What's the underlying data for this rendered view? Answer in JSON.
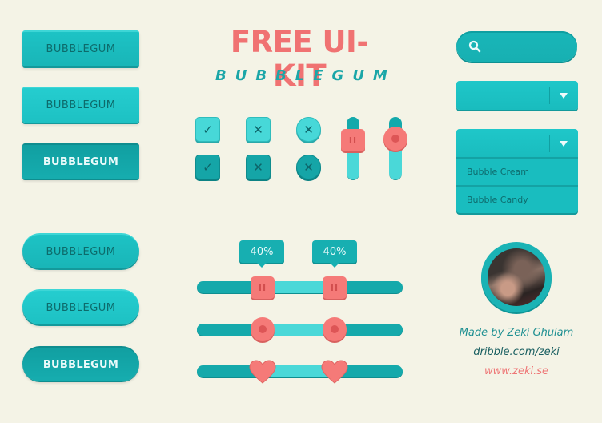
{
  "header": {
    "title": "FREE UI-KIT",
    "subtitle": "BUBBLEGUM"
  },
  "buttons": {
    "square": [
      {
        "label": "BUBBLEGUM",
        "state": "normal"
      },
      {
        "label": "BUBBLEGUM",
        "state": "hover"
      },
      {
        "label": "BUBBLEGUM",
        "state": "active"
      }
    ],
    "pill": [
      {
        "label": "BUBBLEGUM",
        "state": "normal"
      },
      {
        "label": "BUBBLEGUM",
        "state": "hover"
      },
      {
        "label": "BUBBLEGUM",
        "state": "active"
      }
    ]
  },
  "checkboxes": [
    {
      "type": "square",
      "glyph": "✓",
      "icon": "check-icon",
      "state": "light"
    },
    {
      "type": "square",
      "glyph": "✕",
      "icon": "x-icon",
      "state": "light"
    },
    {
      "type": "round",
      "glyph": "✕",
      "icon": "x-icon",
      "state": "light"
    },
    {
      "type": "square",
      "glyph": "✓",
      "icon": "check-icon",
      "state": "dark"
    },
    {
      "type": "square",
      "glyph": "✕",
      "icon": "x-icon",
      "state": "dark"
    },
    {
      "type": "round",
      "glyph": "✕",
      "icon": "x-icon",
      "state": "dark"
    }
  ],
  "vertical_sliders": [
    {
      "handle": "square",
      "grip": "II",
      "value_fraction": 0.3
    },
    {
      "handle": "round",
      "value_fraction": 0.3
    }
  ],
  "range_sliders": [
    {
      "handle": "square",
      "grip": "II",
      "low_label": "40%",
      "high_label": "40%",
      "low": 0.3,
      "high": 0.67
    },
    {
      "handle": "round",
      "low": 0.3,
      "high": 0.67
    },
    {
      "handle": "heart",
      "low": 0.3,
      "high": 0.67
    }
  ],
  "search": {
    "icon": "search-icon",
    "placeholder": ""
  },
  "select_closed": {
    "value": "",
    "icon": "caret-down-icon"
  },
  "select_open": {
    "value": "",
    "icon": "caret-down-icon",
    "options": [
      "Bubble Cream",
      "Bubble Candy"
    ]
  },
  "credits": {
    "made_by": "Made by Zeki Ghulam",
    "dribbble": "dribble.com/zeki",
    "website": "www.zeki.se"
  },
  "colors": {
    "background": "#f4f3e6",
    "teal": "#19b6b8",
    "teal_dark": "#14a2a4",
    "teal_light": "#4ad8d8",
    "coral": "#f57a78",
    "title_coral": "#f07272"
  }
}
